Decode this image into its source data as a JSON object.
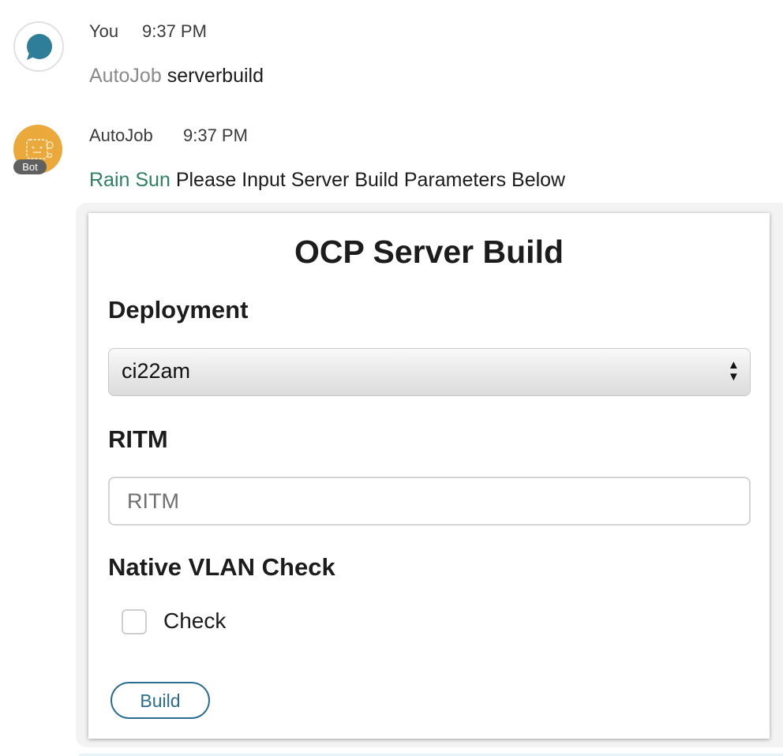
{
  "messages": [
    {
      "author": "You",
      "time": "9:37 PM",
      "mention": "AutoJob",
      "text": "serverbuild",
      "avatar_icon": "chat-bubble-icon"
    },
    {
      "author": "AutoJob",
      "time": "9:37 PM",
      "badge": "Bot",
      "mention": "Rain Sun",
      "text": "Please Input Server Build Parameters Below",
      "avatar_icon": "bot-face-icon"
    }
  ],
  "form": {
    "title": "OCP Server Build",
    "deployment": {
      "label": "Deployment",
      "selected": "ci22am"
    },
    "ritm": {
      "label": "RITM",
      "placeholder": "RITM",
      "value": ""
    },
    "native_vlan": {
      "label": "Native VLAN Check",
      "checkbox_label": "Check",
      "checked": false
    },
    "submit_label": "Build"
  },
  "colors": {
    "user_avatar_bubble": "#2f7e99",
    "bot_avatar": "#eba93b",
    "mention_green": "#2e8060",
    "mention_gray": "#8a8a8a",
    "button_accent": "#2a6d91"
  }
}
